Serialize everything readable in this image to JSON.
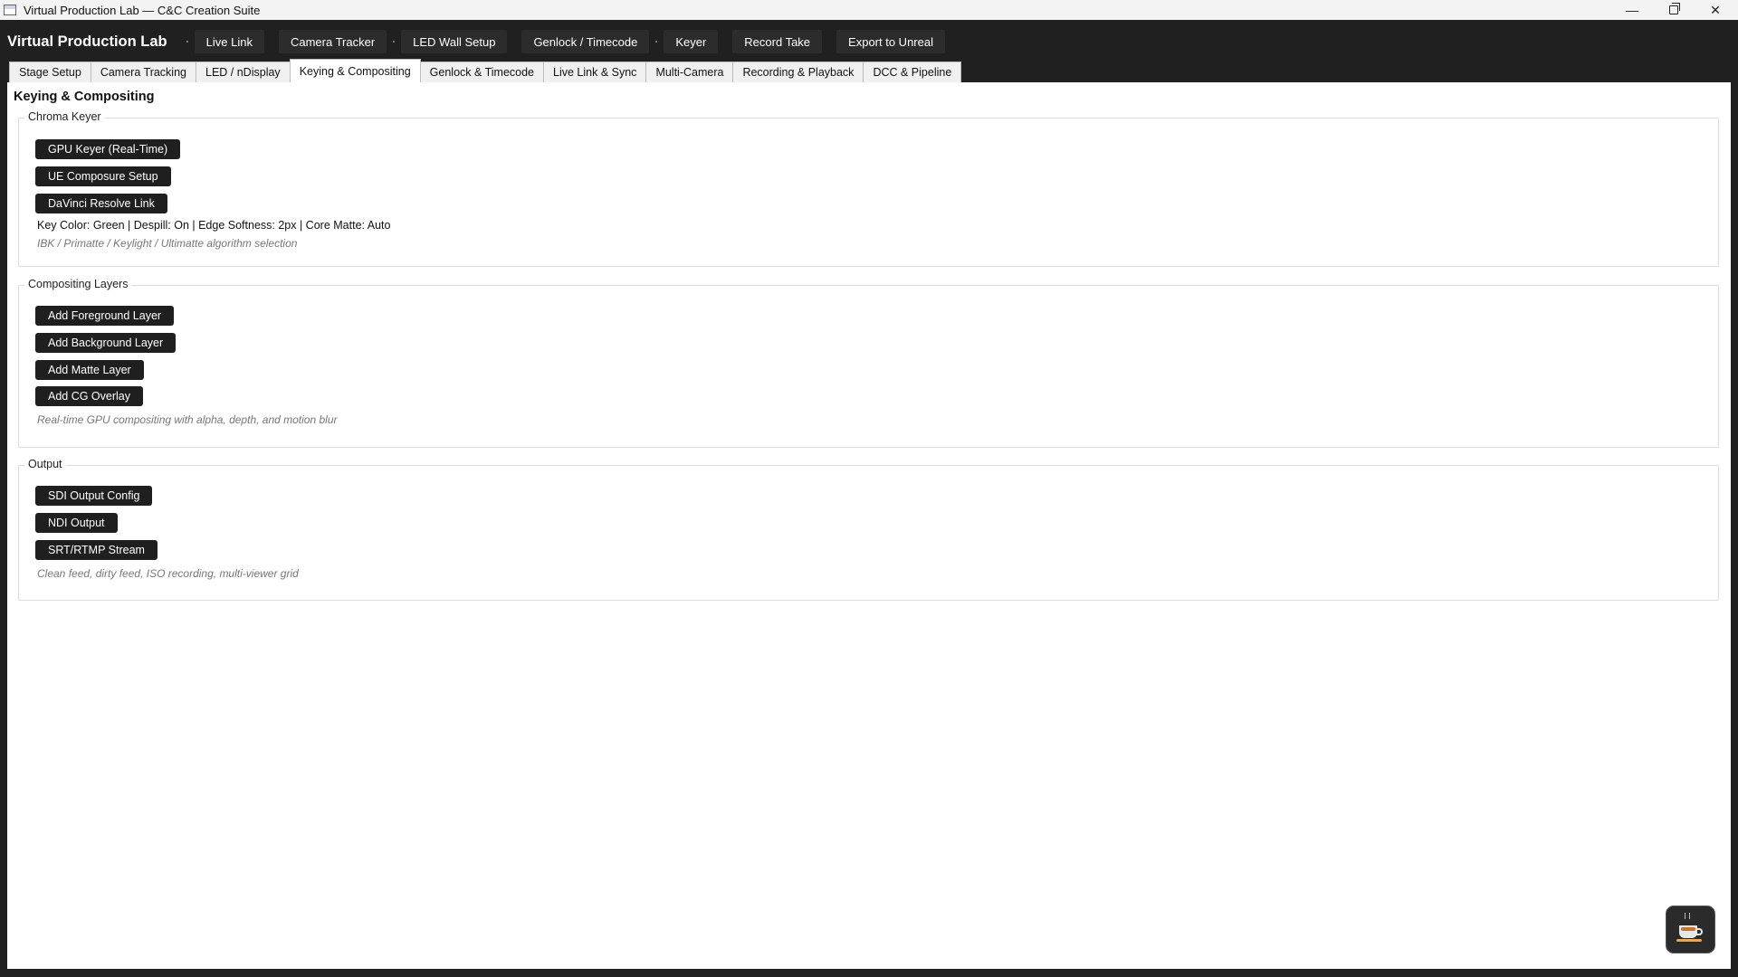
{
  "window": {
    "title": "Virtual Production Lab — C&C Creation Suite",
    "minimize": "—",
    "close": "✕"
  },
  "toolbar": {
    "brand": "Virtual Production Lab",
    "buttons": [
      "Live Link",
      "Camera Tracker",
      "LED Wall Setup",
      "Genlock / Timecode",
      "Keyer",
      "Record Take",
      "Export to Unreal"
    ]
  },
  "tabs": [
    "Stage Setup",
    "Camera Tracking",
    "LED / nDisplay",
    "Keying & Compositing",
    "Genlock & Timecode",
    "Live Link & Sync",
    "Multi-Camera",
    "Recording & Playback",
    "DCC & Pipeline"
  ],
  "page": {
    "title": "Keying & Compositing",
    "chroma": {
      "legend": "Chroma Keyer",
      "buttons": [
        "GPU Keyer (Real-Time)",
        "UE Composure Setup",
        "DaVinci Resolve Link"
      ],
      "info": "Key Color: Green | Despill: On | Edge Softness: 2px | Core Matte: Auto",
      "note": "IBK / Primatte / Keylight / Ultimatte algorithm selection"
    },
    "layers": {
      "legend": "Compositing Layers",
      "buttons": [
        "Add Foreground Layer",
        "Add Background Layer",
        "Add Matte Layer",
        "Add CG Overlay"
      ],
      "note": "Real-time GPU compositing with alpha, depth, and motion blur"
    },
    "output": {
      "legend": "Output",
      "buttons": [
        "SDI Output Config",
        "NDI Output",
        "SRT/RTMP Stream"
      ],
      "note": "Clean feed, dirty feed, ISO recording, multi-viewer grid"
    }
  }
}
